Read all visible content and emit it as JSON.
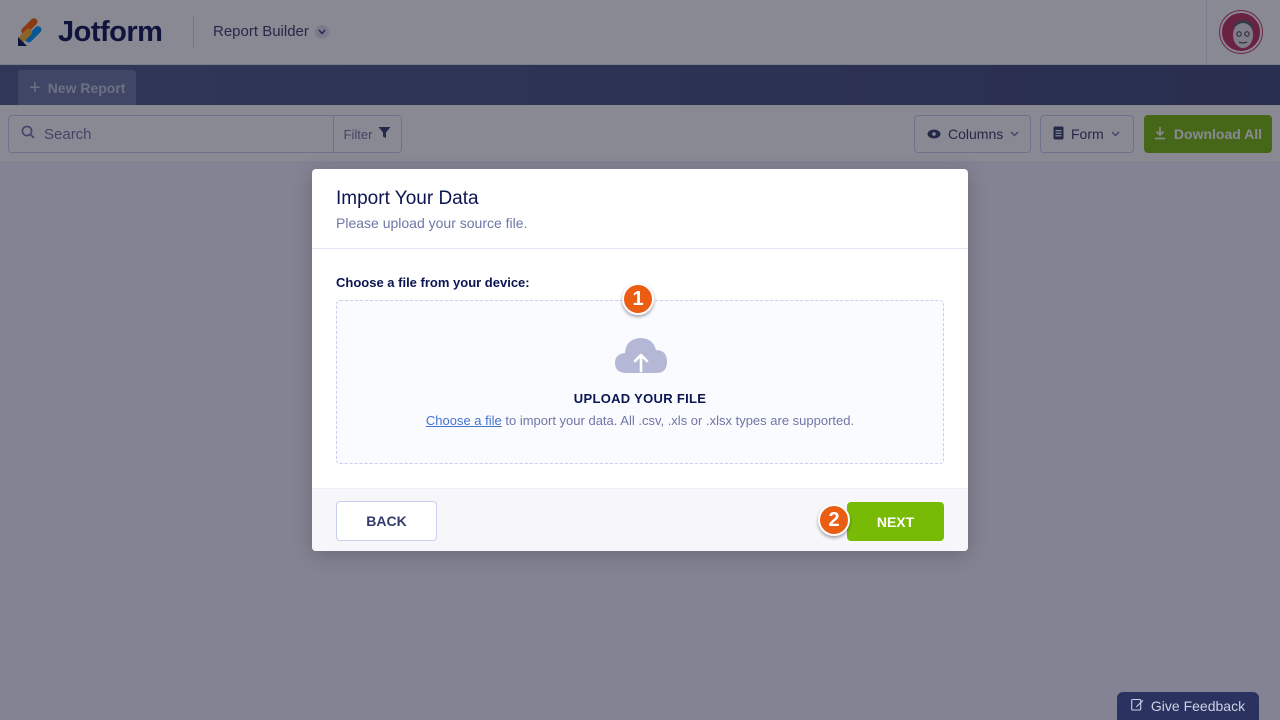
{
  "header": {
    "brand": "Jotform",
    "app_name": "Report Builder"
  },
  "reportbar": {
    "new_report_label": "New Report"
  },
  "toolbar": {
    "search_placeholder": "Search",
    "filter_label": "Filter",
    "columns_label": "Columns",
    "form_label": "Form",
    "download_all_label": "Download All"
  },
  "modal": {
    "title": "Import Your Data",
    "subtitle": "Please upload your source file.",
    "choose_label": "Choose a file from your device:",
    "upload_title": "UPLOAD YOUR FILE",
    "choose_link": "Choose a file",
    "upload_desc": " to import your data. All .csv, .xls or .xlsx types are supported.",
    "back_label": "BACK",
    "next_label": "NEXT"
  },
  "badges": {
    "step1": "1",
    "step2": "2"
  },
  "feedback": {
    "label": "Give Feedback"
  },
  "colors": {
    "accent_green": "#78bb07",
    "badge_orange": "#ec5d14",
    "navy": "#0a1551",
    "link_blue": "#4573d2"
  },
  "icons": {
    "logo": "jotform-logo-icon",
    "search": "search-icon",
    "filter": "filter-funnel-icon",
    "columns": "eye-icon",
    "form": "document-icon",
    "download": "download-icon",
    "upload": "cloud-upload-icon",
    "feedback": "feedback-pencil-icon"
  }
}
